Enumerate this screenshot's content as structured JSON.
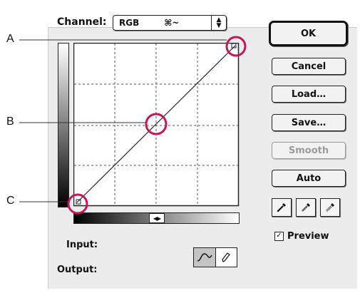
{
  "callouts": [
    {
      "label": "A"
    },
    {
      "label": "B"
    },
    {
      "label": "C"
    }
  ],
  "channel": {
    "label": "Channel:",
    "value": "RGB",
    "shortcut": "⌘~"
  },
  "buttons": {
    "ok": "OK",
    "cancel": "Cancel",
    "load": "Load…",
    "save": "Save…",
    "smooth": "Smooth",
    "auto": "Auto"
  },
  "input_label": "Input:",
  "output_label": "Output:",
  "preview": {
    "label": "Preview",
    "checked": true
  },
  "colors": {
    "callout_circle": "#c2185b",
    "dialog_bg": "#ececec"
  },
  "icons": {
    "curve_tool": "curve-tool-icon",
    "pencil_tool": "pencil-tool-icon",
    "black_eyedropper": "eyedropper-black-icon",
    "gray_eyedropper": "eyedropper-gray-icon",
    "white_eyedropper": "eyedropper-white-icon"
  }
}
